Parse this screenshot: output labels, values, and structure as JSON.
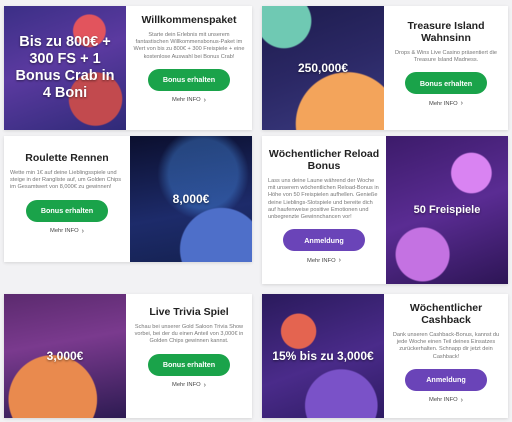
{
  "cards": [
    {
      "overlay": "Bis zu 800€ + 300 FS + 1 Bonus Crab in 4 Boni",
      "title": "Willkommenspaket",
      "desc": "Starte dein Erlebnis mit unserem fantastischen Willkommensbonus-Paket im Wert von bis zu 800€ + 300 Freispiele + eine kostenlose Auswahl bei Bonus Crab!",
      "button": "Bonus erhalten",
      "more": "Mehr INFO"
    },
    {
      "overlay": "250,000€",
      "title": "Treasure Island Wahnsinn",
      "desc": "Drops & Wins Live Casino präsentiert die Treasure Island Madness.",
      "button": "Bonus erhalten",
      "more": "Mehr INFO"
    },
    {
      "overlay": "8,000€",
      "title": "Roulette Rennen",
      "desc": "Wette min 1€ auf deine Lieblingsspiele und steige in der Rangliste auf, um Golden Chips im Gesamtwert von 8,000€ zu gewinnen!",
      "button": "Bonus erhalten",
      "more": "Mehr INFO"
    },
    {
      "overlay": "50 Freispiele",
      "title": "Wöchentlicher Reload Bonus",
      "desc": "Lass uns deine Laune während der Woche mit unserem wöchentlichen Reload-Bonus in Höhe von 50 Freispielen aufhellen. Genieße deine Lieblings-Slotspiele und bereite dich auf haufenweise positive Emotionen und unbegrenzte Gewinnchancen vor!",
      "button": "Anmeldung",
      "more": "Mehr INFO"
    },
    {
      "overlay": "3,000€",
      "title": "Live Trivia Spiel",
      "desc": "Schau bei unserer Gold Saloon Trivia Show vorbei, bei der du einen Anteil von 3,000€ in Golden Chips gewinnen kannst.",
      "button": "Bonus erhalten",
      "more": "Mehr INFO"
    },
    {
      "overlay": "15% bis zu 3,000€",
      "title": "Wöchentlicher Cashback",
      "desc": "Dank unseren Cashback-Bonus, kannst du jede Woche einen Teil deines Einsatzes zurückerhalten. Schnapp dir jetzt dein Cashback!",
      "button": "Anmeldung",
      "more": "Mehr INFO"
    }
  ],
  "colors": {
    "green": "#1aa34a",
    "purple": "#6a44b8"
  },
  "icons": {
    "more": "chevron-right-icon"
  }
}
